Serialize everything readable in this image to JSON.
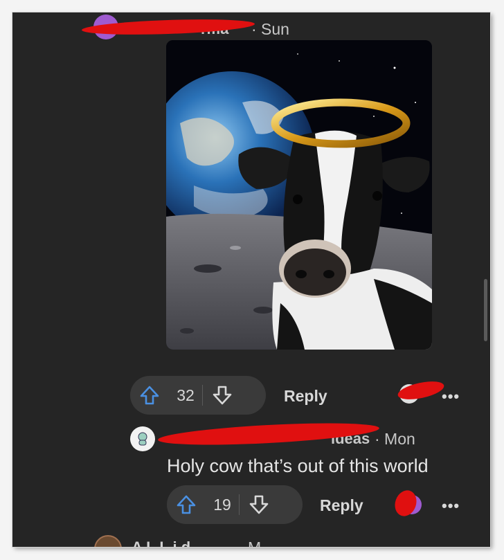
{
  "post": {
    "author_suffix": "rma",
    "time": "· Sun",
    "upvotes": "32",
    "reply_label": "Reply",
    "more_label": "•••"
  },
  "comment": {
    "author_suffix": "ideas",
    "time": "· Mon",
    "body": "Holy cow that’s out of this world",
    "upvotes": "19",
    "reply_label": "Reply",
    "more_label": "•••"
  },
  "next_comment": {
    "author_partial": "A   L   L  i  d",
    "time_partial": "M"
  },
  "colors": {
    "background": "#252525",
    "redaction": "#e01010",
    "upvote_icon": "#4a90e2",
    "text": "#d8d8d8"
  },
  "icons": {
    "upvote": "arrow-up-outline",
    "downvote": "arrow-down-outline",
    "more": "horizontal-ellipsis"
  }
}
